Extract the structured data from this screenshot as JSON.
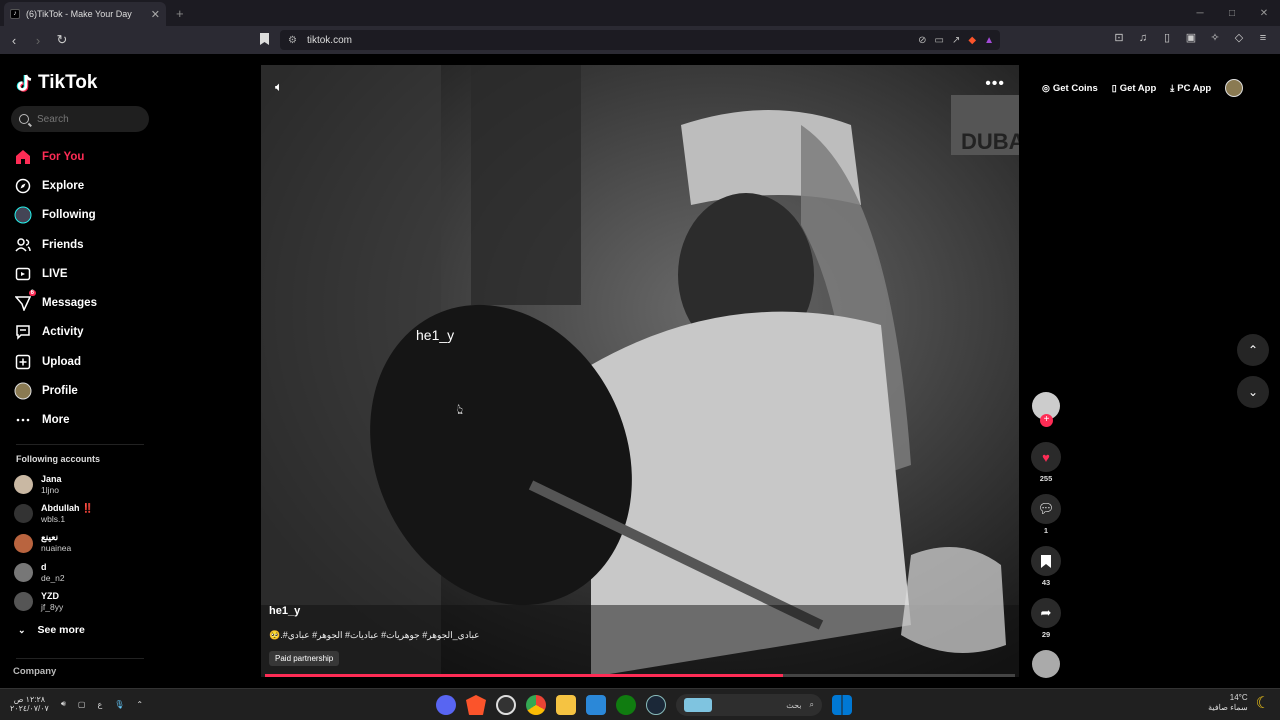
{
  "browser": {
    "tab_title": "(6)TikTok - Make Your Day",
    "tab_close": "✕",
    "new_tab": "+",
    "url": "tiktok.com"
  },
  "sidebar": {
    "logo_text": "TikTok",
    "search_placeholder": "Search",
    "menu": [
      {
        "label": "For You",
        "icon": "home-icon"
      },
      {
        "label": "Explore",
        "icon": "compass-icon"
      },
      {
        "label": "Following",
        "icon": "following-icon"
      },
      {
        "label": "Friends",
        "icon": "friends-icon"
      },
      {
        "label": "LIVE",
        "icon": "live-icon"
      },
      {
        "label": "Messages",
        "icon": "messages-icon",
        "badge": "6"
      },
      {
        "label": "Activity",
        "icon": "activity-icon"
      },
      {
        "label": "Upload",
        "icon": "upload-icon"
      },
      {
        "label": "Profile",
        "icon": "profile-icon"
      },
      {
        "label": "More",
        "icon": "more-icon"
      }
    ],
    "following_title": "Following accounts",
    "accounts": [
      {
        "name": "Jana",
        "handle": "1ljno"
      },
      {
        "name": "Abdullah ‼️",
        "handle": "wbls.1"
      },
      {
        "name": "نعينع",
        "handle": "nuainea"
      },
      {
        "name": "d",
        "handle": "de_n2"
      },
      {
        "name": "YZD",
        "handle": "jf_8yy"
      }
    ],
    "see_more": "See more",
    "company": "Company"
  },
  "header": {
    "get_coins": "Get Coins",
    "get_app": "Get App",
    "pc_app": "PC App"
  },
  "video": {
    "overlay_name": "he1_y",
    "author": "he1_y",
    "caption": "عبادي_الجوهر# جوهريات# عباديات# الجوهر# عبادي#.🥺",
    "paid_label": "Paid partnership",
    "progress": 0.69
  },
  "actions": {
    "likes": "255",
    "comments": "1",
    "saves": "43",
    "shares": "29"
  },
  "taskbar": {
    "time": "١٢:٢٨ ص",
    "date": "٢٠٢٤/٠٧/٠٧",
    "lang": "ع",
    "search_text": "بحث",
    "temp": "14°C",
    "weather": "سماء صافية"
  },
  "colors": {
    "accent": "#fe2c55",
    "background": "#000000"
  }
}
